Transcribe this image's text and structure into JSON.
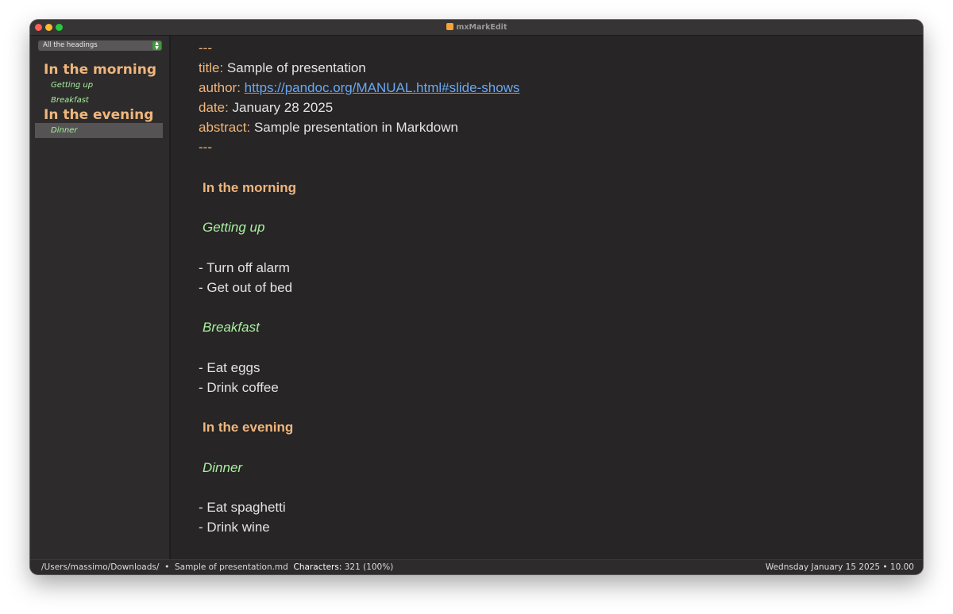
{
  "window": {
    "title": "mxMarkEdit"
  },
  "sidebar": {
    "dropdown": "All the headings",
    "items": [
      {
        "label": "In the morning",
        "level": 1,
        "selected": false
      },
      {
        "label": "Getting up",
        "level": 2,
        "selected": false
      },
      {
        "label": "Breakfast",
        "level": 2,
        "selected": false
      },
      {
        "label": "In the evening",
        "level": 1,
        "selected": false
      },
      {
        "label": "Dinner",
        "level": 2,
        "selected": true
      }
    ]
  },
  "editor": {
    "front_matter_delim": "---",
    "title_key": "title:",
    "title_value": "Sample of presentation",
    "author_key": "author:",
    "author_value": "https://pandoc.org/MANUAL.html#slide-shows",
    "date_key": "date:",
    "date_value": "January 28 2025",
    "abstract_key": "abstract:",
    "abstract_value": "Sample presentation in Markdown",
    "front_matter_end": "---",
    "heading_morning": "In the morning",
    "heading_getting_up": "Getting up",
    "bullet_alarm": "- Turn off alarm",
    "bullet_bed": "- Get out of bed",
    "heading_breakfast": "Breakfast",
    "bullet_eggs": "- Eat eggs",
    "bullet_coffee": "- Drink coffee",
    "heading_evening": "In the evening",
    "heading_dinner": "Dinner",
    "bullet_spaghetti": "- Eat spaghetti",
    "bullet_wine": "- Drink wine"
  },
  "status": {
    "path": "/Users/massimo/Downloads/",
    "separator": "•",
    "filename": "Sample of presentation.md",
    "characters_label": "Characters:",
    "characters_value": "321 (100%)",
    "datetime": "Wednsday January 15 2025 • 10.00"
  },
  "colors": {
    "heading1": "#f0b67d",
    "heading2": "#a8f0a0",
    "link": "#6aa8f2",
    "background": "#272525"
  }
}
